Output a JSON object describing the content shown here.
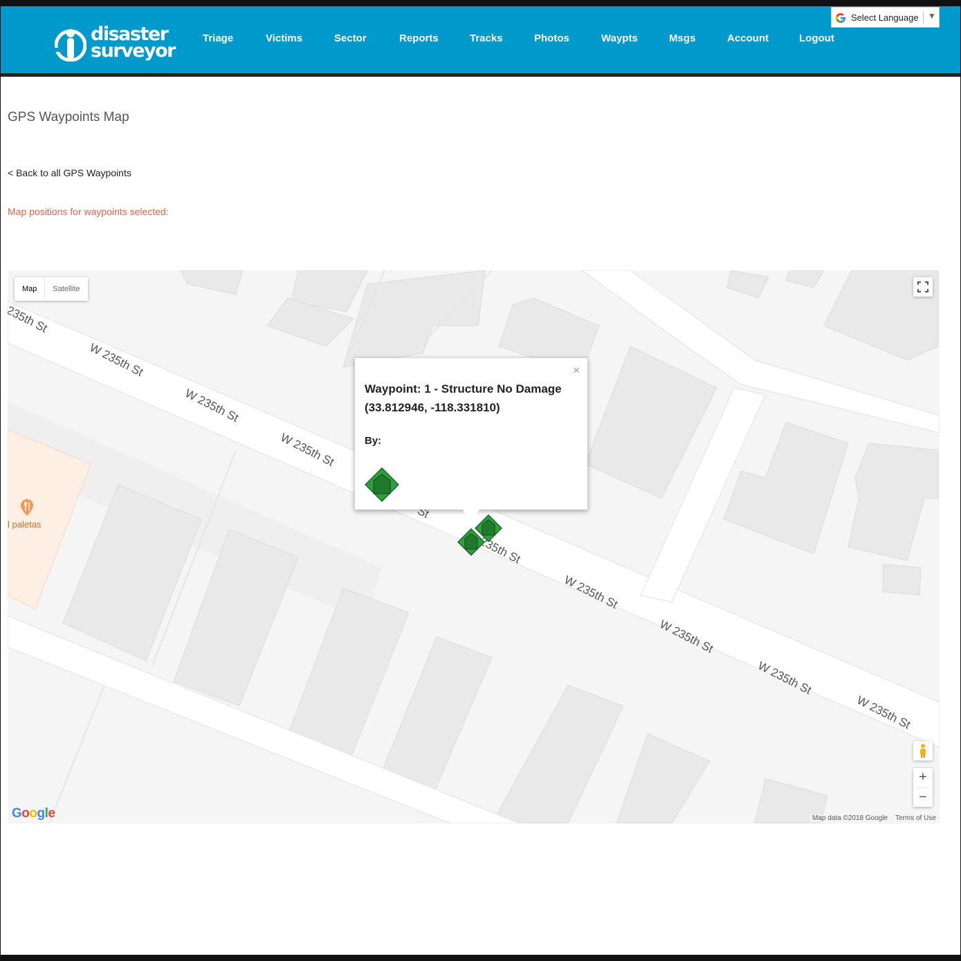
{
  "brand": {
    "line1": "disaster",
    "line2": "surveyor"
  },
  "nav": [
    {
      "label": "Triage",
      "name": "nav-triage"
    },
    {
      "label": "Victims",
      "name": "nav-victims"
    },
    {
      "label": "Sector",
      "name": "nav-sector"
    },
    {
      "label": "Reports",
      "name": "nav-reports"
    },
    {
      "label": "Tracks",
      "name": "nav-tracks"
    },
    {
      "label": "Photos",
      "name": "nav-photos"
    },
    {
      "label": "Waypts",
      "name": "nav-waypts"
    },
    {
      "label": "Msgs",
      "name": "nav-msgs"
    },
    {
      "label": "Account",
      "name": "nav-account"
    },
    {
      "label": "Logout",
      "name": "nav-logout"
    }
  ],
  "translate": {
    "label": "Select Language",
    "arrow": "▼",
    "icon": "google-g-icon"
  },
  "page": {
    "title": "GPS Waypoints Map",
    "back_link": "< Back to all GPS Waypoints",
    "selected_note": "Map positions for waypoints selected:"
  },
  "map": {
    "type_buttons": {
      "map": "Map",
      "satellite": "Satellite"
    },
    "street_labels": [
      "235th St",
      "W 235th St",
      "W 235th St",
      "W 235th St",
      "St",
      "235th St",
      "W 235th St",
      "W 235th St",
      "W 235th St",
      "W 235th St"
    ],
    "place_label": "l paletas",
    "google": "Google",
    "attribution": "Map data ©2018 Google",
    "terms": "Terms of Use",
    "zoom_in": "+",
    "zoom_out": "−",
    "colors": {
      "marker_fill": "#2e9e3e",
      "marker_dark": "#1a6b28",
      "place_area": "#fdefe3",
      "brand_blue": "#0099cc",
      "link_orange": "#e0644b"
    }
  },
  "infowindow": {
    "title": "Waypoint: 1 - Structure No Damage (33.812946, -118.331810)",
    "by_label": "By:",
    "close": "×",
    "icon": "structure-no-damage-icon"
  }
}
